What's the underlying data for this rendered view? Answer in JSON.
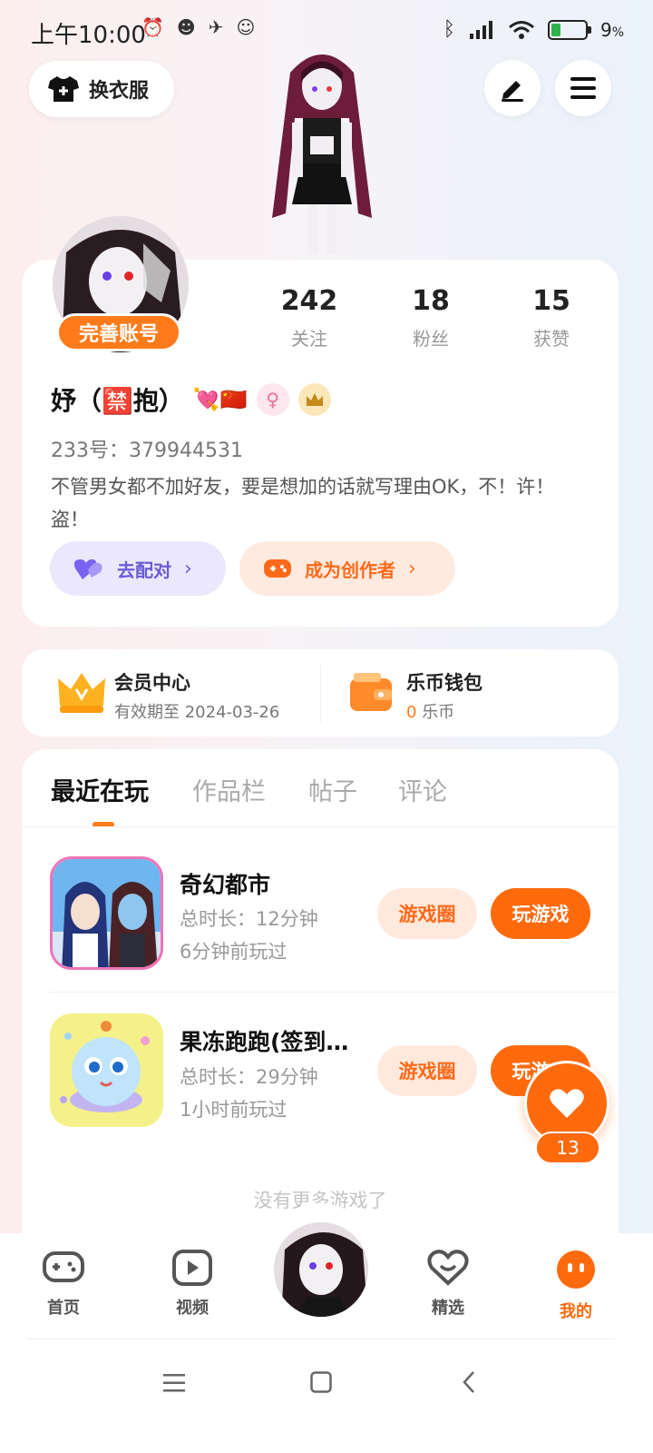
{
  "status_bar": {
    "time": "上午10:00",
    "battery": "9",
    "battery_unit": "%"
  },
  "top": {
    "outfit_label": "换衣服"
  },
  "profile": {
    "badge": "完善账号",
    "stats": [
      {
        "num": "242",
        "label": "关注"
      },
      {
        "num": "18",
        "label": "粉丝"
      },
      {
        "num": "15",
        "label": "获赞"
      }
    ],
    "name": "妤（🈲抱）",
    "name_emoji": "💘🇨🇳",
    "gender_symbol": "♀",
    "id_line": "233号：379944531",
    "bio": "不管男女都不加好友，要是想加的话就写理由OK，不！许！盗！",
    "match_label": "去配对",
    "creator_label": "成为创作者"
  },
  "membership": {
    "member_title": "会员中心",
    "member_sub": "有效期至 2024-03-26",
    "wallet_title": "乐币钱包",
    "wallet_amount": "0",
    "wallet_unit": "乐币"
  },
  "tabs": [
    "最近在玩",
    "作品栏",
    "帖子",
    "评论"
  ],
  "games": [
    {
      "title": "奇幻都市",
      "duration": "总时长：12分钟",
      "last_played": "6分钟前玩过",
      "circle_label": "游戏圈",
      "play_label": "玩游戏"
    },
    {
      "title": "果冻跑跑(签到…",
      "duration": "总时长：29分钟",
      "last_played": "1小时前玩过",
      "circle_label": "游戏圈",
      "play_label": "玩游戏"
    }
  ],
  "no_more": "没有更多游戏了",
  "like_count": "13",
  "nav": [
    {
      "label": "首页",
      "icon": "gamepad-icon"
    },
    {
      "label": "视频",
      "icon": "video-play-icon"
    },
    {
      "label": "精选",
      "icon": "heart-smile-icon"
    },
    {
      "label": "我的",
      "icon": "smile-face-icon"
    }
  ],
  "colors": {
    "accent": "#ff6a0d",
    "match_bg": "#ebe7fd",
    "creator_bg": "#ffeadf"
  }
}
